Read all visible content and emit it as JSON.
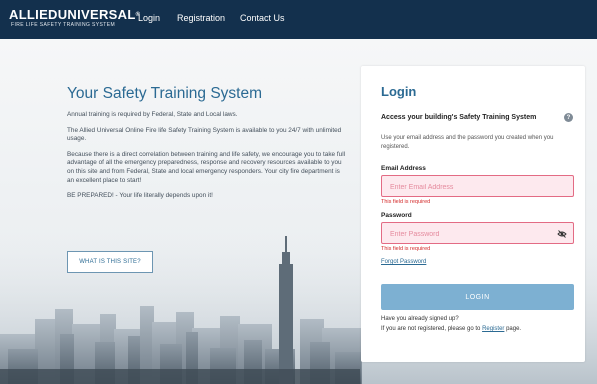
{
  "header": {
    "logo_main": "ALLIEDUNIVERSAL",
    "logo_reg": "®",
    "logo_sub": "FIRE LIFE SAFETY TRAINING SYSTEM",
    "nav": [
      "Login",
      "Registration",
      "Contact Us"
    ],
    "bg_color": "#13304d"
  },
  "intro": {
    "title": "Your Safety Training System",
    "paragraphs": [
      "Annual training is required by Federal, State and Local laws.",
      "The Allied Universal Online Fire life Safety Training System is available to you 24/7 with unlimited usage.",
      "Because there is a direct correlation between training and life safety, we encourage you to take full advantage of all the emergency preparedness, response and recovery resources available to you on this site and from Federal, State and local emergency responders. Your city fire department is an excellent place to start!",
      "BE PREPARED! - Your life literally depends upon it!"
    ],
    "what_button": "WHAT IS THIS SITE?"
  },
  "login": {
    "title": "Login",
    "access_heading": "Access your building's Safety Training System",
    "help_icon": "?",
    "description": "Use your email address and the password you created when you registered.",
    "email_label": "Email Address",
    "email_placeholder": "Enter Email Address",
    "email_value": "",
    "email_error": "This field is required",
    "password_label": "Password",
    "password_placeholder": "Enter Password",
    "password_value": "",
    "password_error": "This field is required",
    "forgot_link": "Forgot Password",
    "login_button": "LOGIN",
    "signed_up_text": "Have you already signed up?",
    "not_registered_prefix": "If you are not registered, please go to ",
    "register_link": "Register",
    "not_registered_suffix": " page.",
    "accent_color": "#2b6a93",
    "error_color": "#d32a2a",
    "button_color": "#7db0d2"
  },
  "icons": {
    "help": "help-icon",
    "password_toggle": "eye-slash-icon"
  }
}
